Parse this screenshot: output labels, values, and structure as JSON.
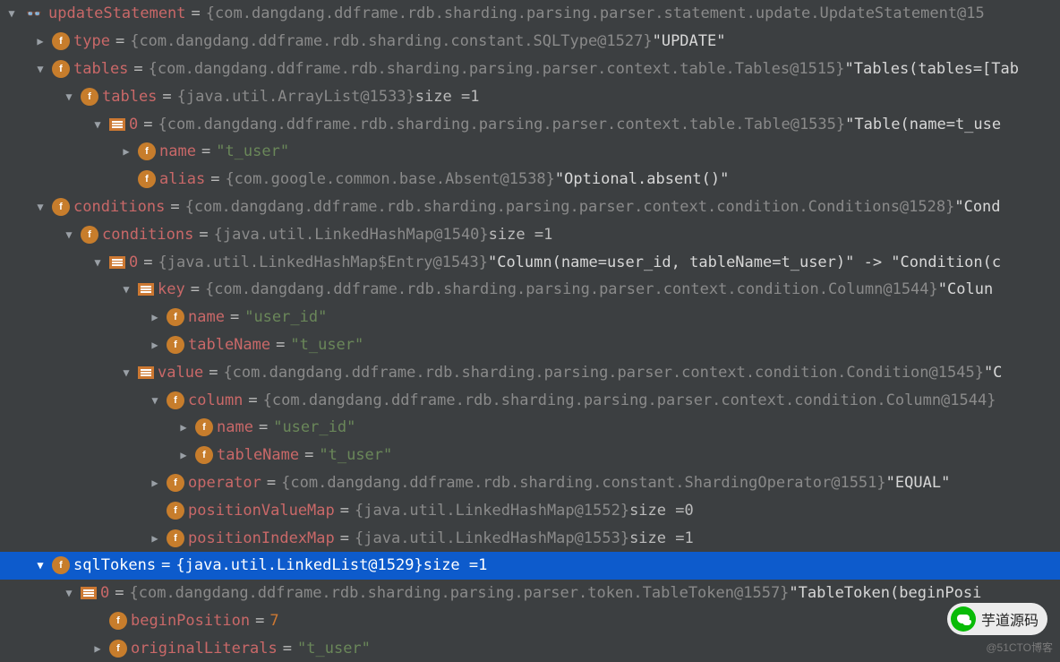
{
  "rows": [
    {
      "indent": 0,
      "arrow": "down",
      "icon": "glasses",
      "name": "updateStatement",
      "gray": "{com.dangdang.ddframe.rdb.sharding.parsing.parser.statement.update.UpdateStatement@15"
    },
    {
      "indent": 1,
      "arrow": "right",
      "icon": "f",
      "name": "type",
      "gray": "{com.dangdang.ddframe.rdb.sharding.constant.SQLType@1527}",
      "white": " \"UPDATE\""
    },
    {
      "indent": 1,
      "arrow": "down",
      "icon": "f",
      "name": "tables",
      "gray": "{com.dangdang.ddframe.rdb.sharding.parsing.parser.context.table.Tables@1515}",
      "white": " \"Tables(tables=[Tab"
    },
    {
      "indent": 2,
      "arrow": "down",
      "icon": "f",
      "name": "tables",
      "gray": "{java.util.ArrayList@1533}",
      "size": "1"
    },
    {
      "indent": 3,
      "arrow": "down",
      "icon": "idx",
      "name": "0",
      "gray": "{com.dangdang.ddframe.rdb.sharding.parsing.parser.context.table.Table@1535}",
      "white": " \"Table(name=t_use"
    },
    {
      "indent": 4,
      "arrow": "right",
      "icon": "f",
      "name": "name",
      "green": "\"t_user\""
    },
    {
      "indent": 4,
      "arrow": "none",
      "icon": "f",
      "name": "alias",
      "gray": "{com.google.common.base.Absent@1538}",
      "white": " \"Optional.absent()\""
    },
    {
      "indent": 1,
      "arrow": "down",
      "icon": "f",
      "name": "conditions",
      "gray": "{com.dangdang.ddframe.rdb.sharding.parsing.parser.context.condition.Conditions@1528}",
      "white": " \"Cond"
    },
    {
      "indent": 2,
      "arrow": "down",
      "icon": "f",
      "name": "conditions",
      "gray": "{java.util.LinkedHashMap@1540}",
      "size": "1"
    },
    {
      "indent": 3,
      "arrow": "down",
      "icon": "idx",
      "name": "0",
      "gray": "{java.util.LinkedHashMap$Entry@1543}",
      "white": " \"Column(name=user_id, tableName=t_user)\" -> \"Condition(c"
    },
    {
      "indent": 4,
      "arrow": "down",
      "icon": "idx",
      "name": "key",
      "gray": "{com.dangdang.ddframe.rdb.sharding.parsing.parser.context.condition.Column@1544}",
      "white": " \"Colun"
    },
    {
      "indent": 5,
      "arrow": "right",
      "icon": "f",
      "name": "name",
      "green": "\"user_id\""
    },
    {
      "indent": 5,
      "arrow": "right",
      "icon": "f",
      "name": "tableName",
      "green": "\"t_user\""
    },
    {
      "indent": 4,
      "arrow": "down",
      "icon": "idx",
      "name": "value",
      "gray": "{com.dangdang.ddframe.rdb.sharding.parsing.parser.context.condition.Condition@1545}",
      "white": " \"C"
    },
    {
      "indent": 5,
      "arrow": "down",
      "icon": "f",
      "name": "column",
      "gray": "{com.dangdang.ddframe.rdb.sharding.parsing.parser.context.condition.Column@1544}"
    },
    {
      "indent": 6,
      "arrow": "right",
      "icon": "f",
      "name": "name",
      "green": "\"user_id\""
    },
    {
      "indent": 6,
      "arrow": "right",
      "icon": "f",
      "name": "tableName",
      "green": "\"t_user\""
    },
    {
      "indent": 5,
      "arrow": "right",
      "icon": "f",
      "name": "operator",
      "gray": "{com.dangdang.ddframe.rdb.sharding.constant.ShardingOperator@1551}",
      "white": " \"EQUAL\""
    },
    {
      "indent": 5,
      "arrow": "none",
      "icon": "f",
      "name": "positionValueMap",
      "gray": "{java.util.LinkedHashMap@1552}",
      "size": "0"
    },
    {
      "indent": 5,
      "arrow": "right",
      "icon": "f",
      "name": "positionIndexMap",
      "gray": "{java.util.LinkedHashMap@1553}",
      "size": "1"
    },
    {
      "indent": 1,
      "arrow": "down",
      "icon": "f",
      "name": "sqlTokens",
      "gray": "{java.util.LinkedList@1529}",
      "size": "1",
      "selected": true
    },
    {
      "indent": 2,
      "arrow": "down",
      "icon": "idx",
      "name": "0",
      "gray": "{com.dangdang.ddframe.rdb.sharding.parsing.parser.token.TableToken@1557}",
      "white": " \"TableToken(beginPosi"
    },
    {
      "indent": 3,
      "arrow": "none",
      "icon": "f",
      "name": "beginPosition",
      "yellow": "7"
    },
    {
      "indent": 3,
      "arrow": "right",
      "icon": "f",
      "name": "originalLiterals",
      "green": "\"t_user\""
    }
  ],
  "sizeLabel": "size",
  "watermarkBrand": "芋道源码",
  "watermarkText": "@51CTO博客"
}
